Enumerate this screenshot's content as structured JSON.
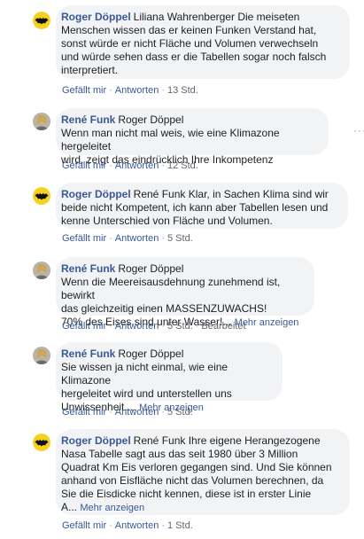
{
  "comments": [
    {
      "author": "Roger Döppel",
      "mention": "Liliana Wahrenberger",
      "lines": [
        "Die meiseten",
        "Menschen wissen das er keinen Funken Verstand hat,",
        "sonst würde er nicht Fläche und Volumen verwechseln",
        "und würde sehen dass er die Tabellen sogar noch falsch",
        "interpretiert."
      ],
      "more": "",
      "like": "Gefällt mir",
      "reply": "Antworten",
      "time": "13 Std.",
      "edited": "",
      "avatar": "batman-icon"
    },
    {
      "author": "René Funk",
      "mention": "Roger Döppel",
      "lines": [
        "",
        "Wenn man nicht mal weis, wie eine Klimazone hergeleitet",
        "wird, zeigt das eindrücklich Ihre Inkompetenz"
      ],
      "more": "",
      "like": "Gefällt mir",
      "reply": "Antworten",
      "time": "12 Std.",
      "edited": "",
      "avatar": "profile-photo"
    },
    {
      "author": "Roger Döppel",
      "mention": "René Funk",
      "lines": [
        "Klar, in Sachen Klima sind wir",
        "beide nicht Kompetent, ich kann aber Tabellen lesen und",
        "kenne Unterschied von Fläche und Volumen."
      ],
      "more": "",
      "like": "Gefällt mir",
      "reply": "Antworten",
      "time": "5 Std.",
      "edited": "",
      "avatar": "batman-icon"
    },
    {
      "author": "René Funk",
      "mention": "Roger Döppel",
      "lines": [
        "",
        "Wenn die Meereisausdehnung zunehmend ist, bewirkt",
        "das gleichzeitig einen MASSENZUWACHS!",
        "70% des Eises sind unter Wasser!..."
      ],
      "more": "Mehr anzeigen",
      "like": "Gefällt mir",
      "reply": "Antworten",
      "time": "5 Std.",
      "edited": "Bearbeitet",
      "avatar": "profile-photo"
    },
    {
      "author": "René Funk",
      "mention": "Roger Döppel",
      "lines": [
        "",
        "Sie wissen ja nicht einmal, wie eine Klimazone",
        "hergeleitet wird und unterstellen uns",
        "Unwissenheit...."
      ],
      "more": "Mehr anzeigen",
      "like": "Gefällt mir",
      "reply": "Antworten",
      "time": "5 Std.",
      "edited": "",
      "avatar": "profile-photo"
    },
    {
      "author": "Roger Döppel",
      "mention": "René Funk",
      "lines": [
        "Ihre eigene Herangezogene",
        "Nasa Tabelle sagt aus das seit 1980 über 3 Million",
        "Quadrat Km Eis verloren gegangen sind. Und Sie können",
        "anhand von Eisfläche nicht das Volumen berechnen, da",
        "Sie die Eisdicke nicht kennen, diese ist in erster Linie",
        "A..."
      ],
      "more": "Mehr anzeigen",
      "like": "Gefällt mir",
      "reply": "Antworten",
      "time": "1 Std.",
      "edited": "",
      "avatar": "batman-icon"
    }
  ],
  "options_icon": "more-options-icon",
  "colors": {
    "link": "#385898",
    "bubble": "#f2f3f5",
    "meta": "#606770"
  }
}
